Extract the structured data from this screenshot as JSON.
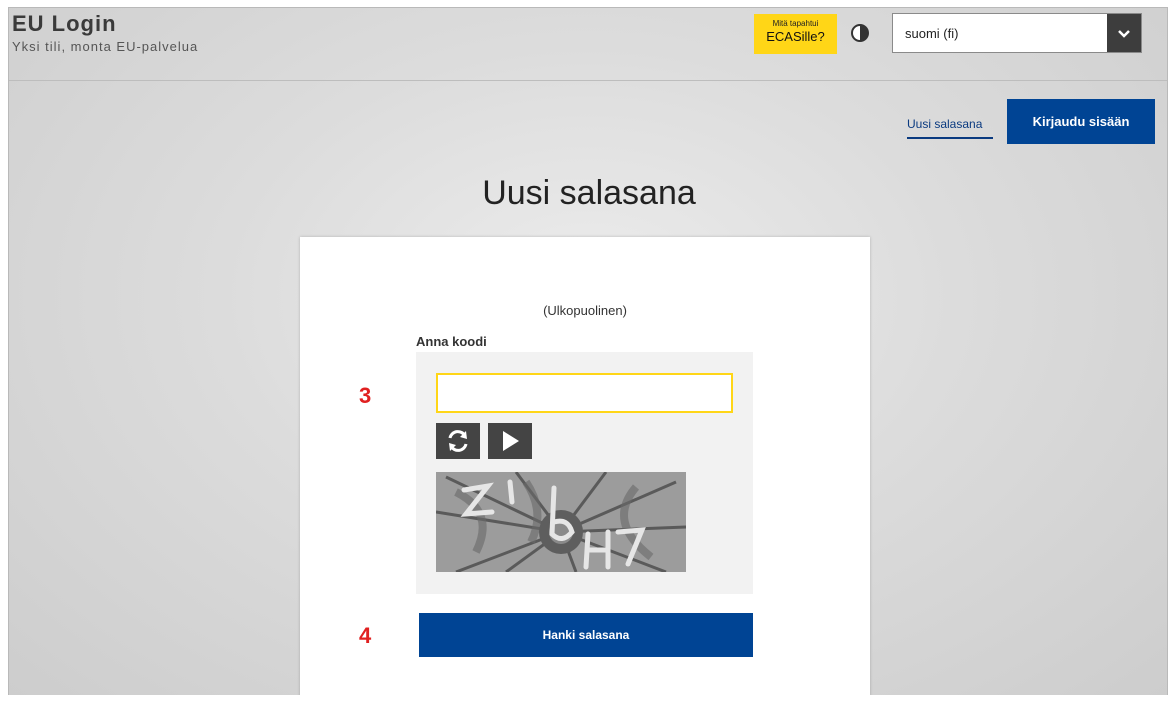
{
  "header": {
    "title": "EU Login",
    "subtitle": "Yksi tili, monta EU-palvelua",
    "news_badge_small": "Mitä tapahtui",
    "news_badge_big": "ECASille?",
    "contrast_icon": "contrast-icon",
    "language_value": "suomi (fi)",
    "language_arrow_icon": "chevron-down-icon"
  },
  "nav": {
    "new_password_link": "Uusi salasana",
    "login_button": "Kirjaudu sisään"
  },
  "main": {
    "title": "Uusi salasana",
    "account_type": "(Ulkopuolinen)",
    "code_label": "Anna koodi",
    "code_value": "",
    "refresh_icon": "refresh-icon",
    "audio_icon": "play-icon",
    "submit_button": "Hanki salasana"
  },
  "annotations": {
    "step_3": "3",
    "step_4": "4"
  },
  "colors": {
    "primary": "#004494",
    "accent_yellow": "#ffd617",
    "annotation_red": "#e02020"
  }
}
